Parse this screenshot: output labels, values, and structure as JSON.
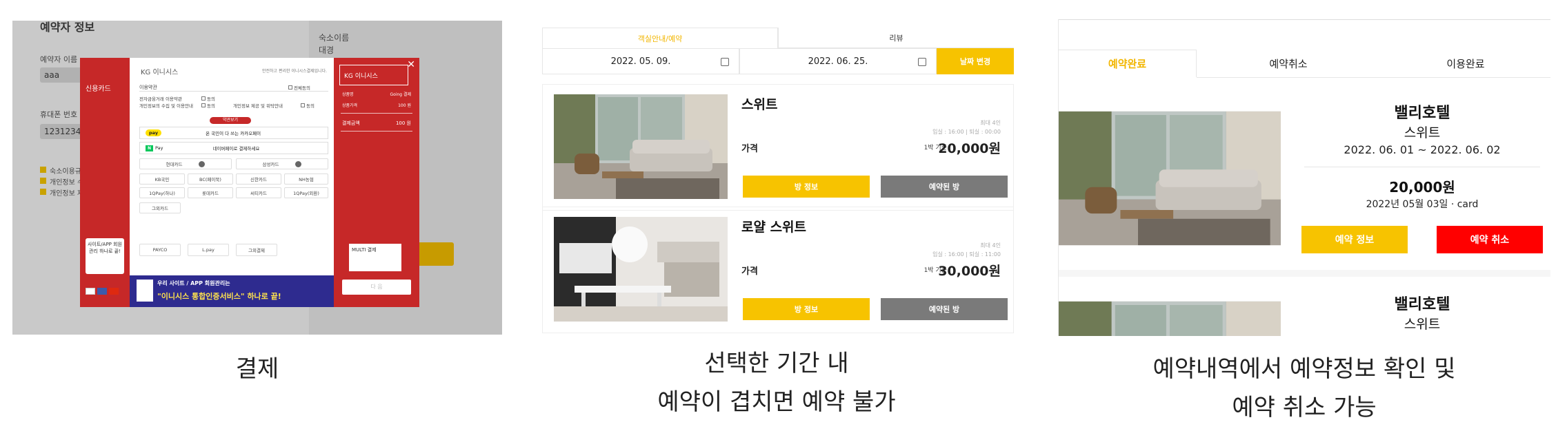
{
  "panel1": {
    "bg_heading": "예약자 정보",
    "bg_name_label": "예약자 이름",
    "bg_name_value": "aaa",
    "bg_phone_label": "휴대폰 번호",
    "bg_phone_value": "12312341",
    "bg_hotel_label": "숙소이름",
    "bg_hotel_value": "대경",
    "bg_agree1": "숙소이용규",
    "bg_agree2": "개인정보 수",
    "bg_agree3": "개인정보 제",
    "modal": {
      "left_label": "신용카드",
      "logo": "KG 이니시스",
      "top_text": "안전하고 편리한 이니시스결제입니다.",
      "terms_label": "이용약관",
      "agree_all": "전체동의",
      "term1": "전자금융거래 이용약관",
      "term2": "개인정보의 수집 및 이용안내",
      "term3": "개인정보 제공 및 위탁안내",
      "agree": "동의",
      "more": "약관보기",
      "kpay_badge": "pay",
      "kpay_text": "온 국민이 다 쓰는 카카오페이",
      "npay_badge": "N",
      "npay_label": "Pay",
      "npay_text": "네이버페이로 결제하세요",
      "card_hyundai": "현대카드",
      "card_samsung": "삼성카드",
      "cards": [
        "KB국민",
        "BC(페이북)",
        "신한카드",
        "NH농협",
        "1QPay(하나)",
        "롯데카드",
        "씨티카드",
        "1QPay(외환)"
      ],
      "card_other": "그외카드",
      "payco": "PAYCO",
      "lpay": "L.pay",
      "etc": "그외결제",
      "ad_line1": "우리 사이트 / APP 회원관리는",
      "ad_line2": "\"이니시스 통합인증서비스\" 하나로 끝!",
      "small_banner": "사이트/APP 회원관리 하나로 끝!",
      "right_logo": "KG 이니시스",
      "product_label": "상품명",
      "product_value": "Going 결제",
      "price_label": "상품가격",
      "price_value": "100 원",
      "total_label": "결제금액",
      "total_value": "100 원",
      "multi_text": "MULTI 결제",
      "ok": "다 음"
    }
  },
  "panel2": {
    "tab_active": "객실안내/예약",
    "tab_review": "리뷰",
    "date_start": "2022. 05. 09.",
    "date_end": "2022. 06. 25.",
    "date_change": "날짜 변경",
    "rooms": [
      {
        "name": "스위트",
        "max": "최대 4인",
        "times": "입실 : 16:00 | 퇴실 : 00:00",
        "price_label": "가격",
        "per_night": "1박 기준",
        "price": "20,000원",
        "btn_info": "방 정보",
        "btn_booked": "예약된 방"
      },
      {
        "name": "로얄 스위트",
        "max": "최대 4인",
        "times": "입실 : 16:00 | 퇴실 : 11:00",
        "price_label": "가격",
        "per_night": "1박 기준",
        "price": "30,000원",
        "btn_info": "방 정보",
        "btn_booked": "예약된 방"
      }
    ]
  },
  "panel3": {
    "tabs": [
      "예약완료",
      "예약취소",
      "이용완료"
    ],
    "items": [
      {
        "hotel": "밸리호텔",
        "room": "스위트",
        "dates": "2022. 06. 01 ~ 2022. 06. 02",
        "price": "20,000원",
        "paid": "2022년 05월 03일 · card",
        "btn_info": "예약 정보",
        "btn_cancel": "예약 취소"
      },
      {
        "hotel": "밸리호텔",
        "room": "스위트"
      }
    ]
  },
  "captions": {
    "c1": "결제",
    "c2_line1": "선택한 기간 내",
    "c2_line2": "예약이 겹치면 예약 불가",
    "c3_line1": "예약내역에서 예약정보 확인 및",
    "c3_line2": "예약 취소 가능"
  },
  "colors": {
    "accent_yellow": "#f7c300",
    "cancel_red": "#ff0000",
    "inicis_red": "#c62828",
    "booked_gray": "#7a7a7a"
  }
}
